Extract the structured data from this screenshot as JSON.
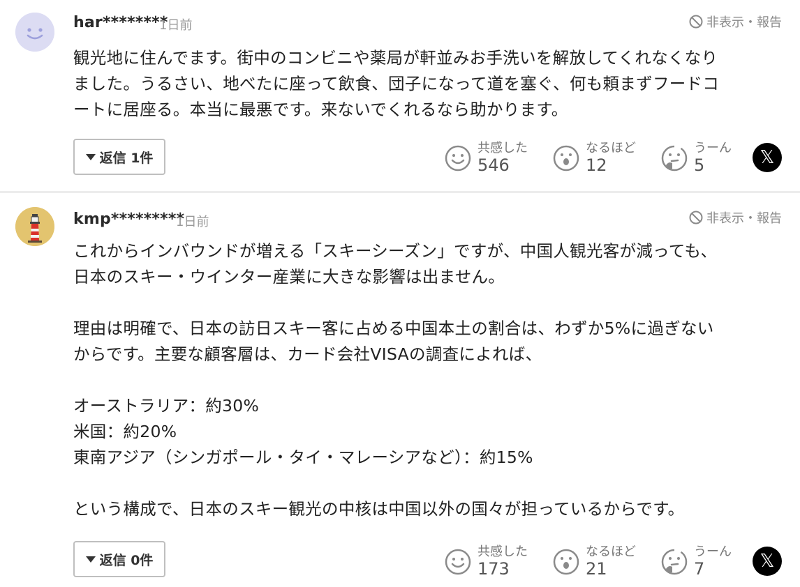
{
  "comments": [
    {
      "username": "har********",
      "time": "1日前",
      "report_label": "非表示・報告",
      "avatar_icon": "smiley-face-avatar",
      "body": [
        "観光地に住んでます。街中のコンビニや薬局が軒並みお手洗いを解放してくれなくなり",
        "ました。うるさい、地べたに座って飲食、団子になって道を塞ぐ、何も頼まずフードコ",
        "ートに居座る。本当に最悪です。来ないでくれるなら助かります。"
      ],
      "reply_label": "返信 1件",
      "reactions": [
        {
          "label": "共感した",
          "count": "546",
          "icon": "smile-icon"
        },
        {
          "label": "なるほど",
          "count": "12",
          "icon": "surprised-icon"
        },
        {
          "label": "うーん",
          "count": "5",
          "icon": "thinking-icon"
        }
      ],
      "share_icon": "x-share-icon"
    },
    {
      "username": "kmp*********",
      "time": "1日前",
      "report_label": "非表示・報告",
      "avatar_icon": "lighthouse-avatar",
      "body": [
        "これからインバウンドが増える「スキーシーズン」ですが、中国人観光客が減っても、",
        "日本のスキー・ウインター産業に大きな影響は出ません。",
        "",
        "理由は明確で、日本の訪日スキー客に占める中国本土の割合は、わずか5%に過ぎない",
        "からです。主要な顧客層は、カード会社VISAの調査によれば、",
        "",
        "オーストラリア：約30%",
        "米国：約20%",
        "東南アジア（シンガポール・タイ・マレーシアなど）：約15%",
        "",
        "という構成で、日本のスキー観光の中核は中国以外の国々が担っているからです。"
      ],
      "reply_label": "返信 0件",
      "reactions": [
        {
          "label": "共感した",
          "count": "173",
          "icon": "smile-icon"
        },
        {
          "label": "なるほど",
          "count": "21",
          "icon": "surprised-icon"
        },
        {
          "label": "うーん",
          "count": "7",
          "icon": "thinking-icon"
        }
      ],
      "share_icon": "x-share-icon"
    }
  ],
  "x_glyph": "𝕏",
  "colors": {
    "icon_gray": "#8a8a8a",
    "avatar1_bg": "#dcdcf3",
    "avatar2_bg": "#e3c46f"
  }
}
